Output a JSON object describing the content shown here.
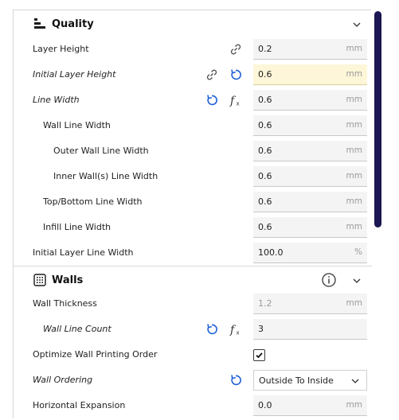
{
  "colors": {
    "accent_blue": "#1e5fd6",
    "scrollbar": "#1a1752",
    "highlight_field": "#fdf6d8"
  },
  "sections": {
    "quality": {
      "title": "Quality",
      "icon": "quality-layers-icon",
      "rows": [
        {
          "label": "Layer Height",
          "value": "0.2",
          "unit": "mm"
        },
        {
          "label": "Initial Layer Height",
          "value": "0.6",
          "unit": "mm"
        },
        {
          "label": "Line Width",
          "value": "0.6",
          "unit": "mm"
        },
        {
          "label": "Wall Line Width",
          "value": "0.6",
          "unit": "mm"
        },
        {
          "label": "Outer Wall Line Width",
          "value": "0.6",
          "unit": "mm"
        },
        {
          "label": "Inner Wall(s) Line Width",
          "value": "0.6",
          "unit": "mm"
        },
        {
          "label": "Top/Bottom Line Width",
          "value": "0.6",
          "unit": "mm"
        },
        {
          "label": "Infill Line Width",
          "value": "0.6",
          "unit": "mm"
        },
        {
          "label": "Initial Layer Line Width",
          "value": "100.0",
          "unit": "%"
        }
      ]
    },
    "walls": {
      "title": "Walls",
      "icon": "walls-grid-icon",
      "rows": [
        {
          "label": "Wall Thickness",
          "value": "1.2",
          "unit": "mm"
        },
        {
          "label": "Wall Line Count",
          "value": "3"
        },
        {
          "label": "Optimize Wall Printing Order",
          "checked": true
        },
        {
          "label": "Wall Ordering",
          "value": "Outside To Inside"
        },
        {
          "label": "Horizontal Expansion",
          "value": "0.0",
          "unit": "mm"
        }
      ]
    }
  }
}
